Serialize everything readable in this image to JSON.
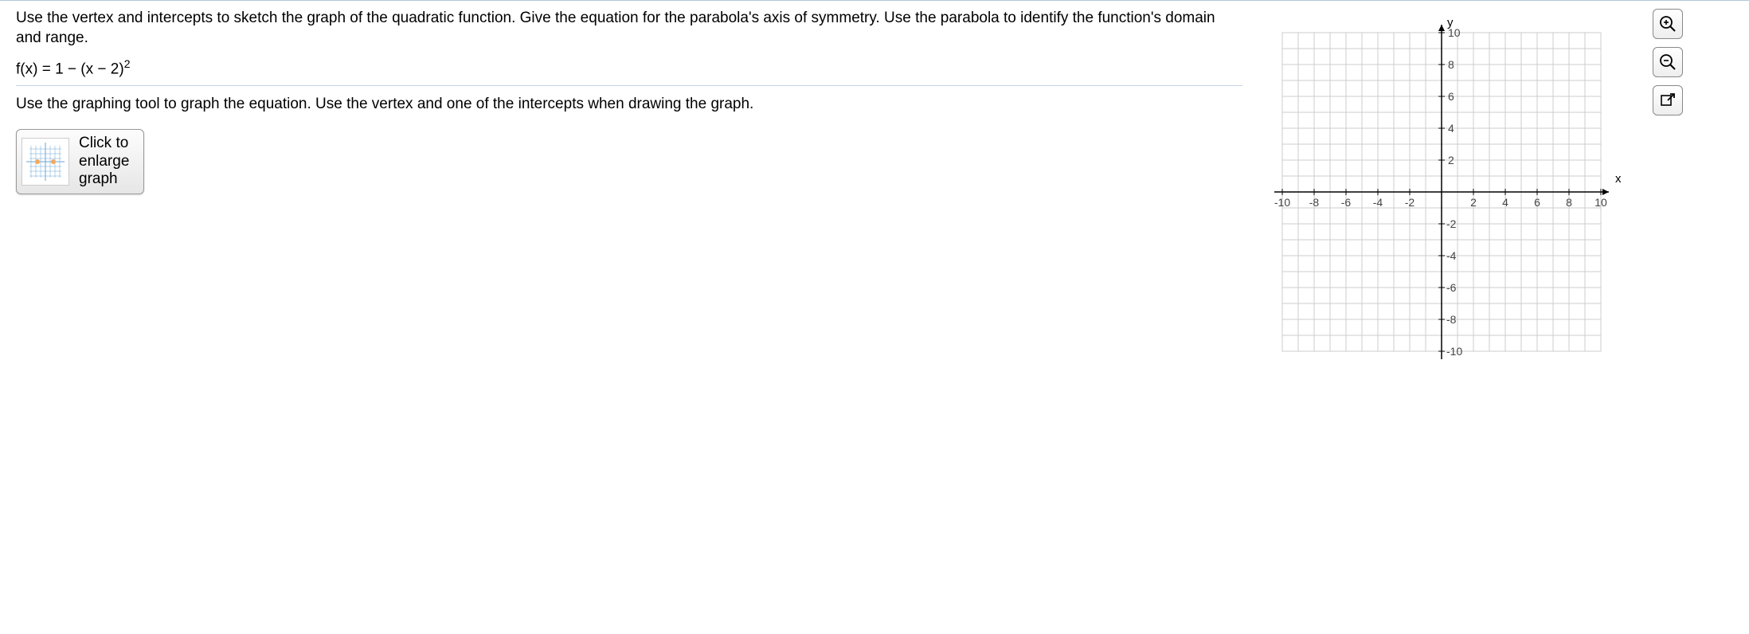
{
  "question": {
    "intro1": "Use the vertex and intercepts to sketch the graph of the quadratic function. Give the equation for the parabola's axis of symmetry.  Use the parabola to identify the function's domain and range.",
    "equation_lhs": "f(x) = 1 − (x − 2)",
    "equation_exp": "2",
    "instruction": "Use the graphing tool to graph the equation.  Use the vertex and one of the intercepts when drawing the graph.",
    "button_line1": "Click to",
    "button_line2": "enlarge",
    "button_line3": "graph"
  },
  "graph": {
    "x_label": "x",
    "y_label": "y",
    "x_ticks": [
      "-10",
      "-8",
      "-6",
      "-4",
      "-2",
      "2",
      "4",
      "6",
      "8",
      "10"
    ],
    "y_ticks_pos": [
      "10",
      "8",
      "6",
      "4",
      "2"
    ],
    "y_ticks_neg": [
      "-2",
      "-4",
      "-6",
      "-8",
      "-10"
    ]
  },
  "chart_data": {
    "type": "scatter",
    "title": "",
    "xlabel": "x",
    "ylabel": "y",
    "xlim": [
      -10,
      10
    ],
    "ylim": [
      -10,
      10
    ],
    "x_tick_interval": 2,
    "y_tick_interval": 2,
    "series": [
      {
        "name": "f(x)=1-(x-2)^2",
        "values": []
      }
    ]
  }
}
